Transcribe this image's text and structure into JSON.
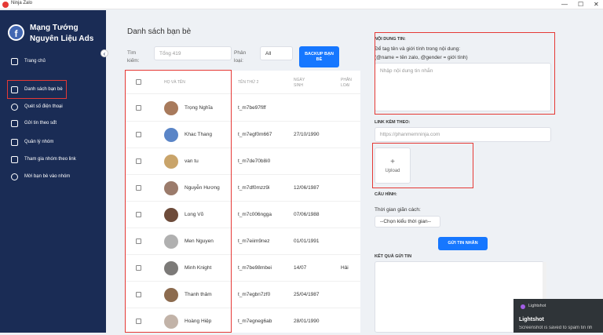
{
  "window": {
    "title": "Ninja Zalo",
    "min": "—",
    "max": "☐",
    "close": "✕"
  },
  "brand": {
    "logo": "f",
    "line1": "Mạng Tướng",
    "line2": "Nguyên Liệu Ads",
    "collapse": "‹"
  },
  "nav": [
    {
      "label": "Trang chủ"
    },
    {
      "label": "Danh sách bạn bè"
    },
    {
      "label": "Quét số điện thoại"
    },
    {
      "label": "Gửi tin theo sđt"
    },
    {
      "label": "Quản lý nhóm"
    },
    {
      "label": "Tham gia nhóm theo link"
    },
    {
      "label": "Mời bạn bè vào nhóm"
    }
  ],
  "page": {
    "title": "Danh sách bạn bè",
    "search_label": "Tìm kiếm:",
    "search_placeholder": "Tổng 419",
    "filter_label": "Phân loại:",
    "filter_value": "All",
    "backup_button": "BACKUP BẠN BÈ"
  },
  "table": {
    "headers": [
      "HỌ VÀ TÊN",
      "TÊN THỨ 2",
      "NGÀY SINH",
      "PHÂN LOẠI"
    ],
    "rows": [
      {
        "name": "Trọng Nghĩa",
        "alias": "t_m7be97fiff",
        "dob": "",
        "type": ""
      },
      {
        "name": "Khac Thang",
        "alias": "t_m7egf0m667",
        "dob": "27/10/1990",
        "type": ""
      },
      {
        "name": "van tu",
        "alias": "t_m7de70b8i0",
        "dob": "",
        "type": ""
      },
      {
        "name": "Nguyễn Hương",
        "alias": "t_m7df0mzz9i",
        "dob": "12/06/1987",
        "type": ""
      },
      {
        "name": "Long Võ",
        "alias": "t_m7c006ngga",
        "dob": "07/06/1988",
        "type": ""
      },
      {
        "name": "Men Nguyen",
        "alias": "t_m7eiim9nez",
        "dob": "01/01/1991",
        "type": ""
      },
      {
        "name": "Minh Knight",
        "alias": "t_m7be98mbei",
        "dob": "14/07",
        "type": "Hải"
      },
      {
        "name": "Thanh thảm",
        "alias": "t_m7egbn7zf0",
        "dob": "25/04/1987",
        "type": ""
      },
      {
        "name": "Hoàng Hiệp",
        "alias": "t_m7egneg6ab",
        "dob": "28/01/1990",
        "type": ""
      }
    ]
  },
  "panel": {
    "content_label": "NỘI DUNG TIN:",
    "hint1": "Để tag tên và giới tính trong nội dung:",
    "hint2": "(@name = tên zalo, @gender = giới tính)",
    "message_placeholder": "Nhập nội dung tin nhắn",
    "link_label": "LINK KÈM THEO:",
    "link_placeholder": "https://phanmemninja.com",
    "upload_plus": "+",
    "upload_label": "Upload",
    "config_label": "CẤU HÌNH:",
    "interval_label": "Thời gian giãn cách:",
    "interval_placeholder": "--Chọn kiểu thời gian--",
    "send_button": "GỬI TIN NHẮN",
    "result_label": "KẾT QUẢ GỬI TIN"
  },
  "toast": {
    "app": "Lightshot",
    "title": "Lightshot",
    "text": "Screenshot is saved to spam tin nh"
  },
  "colors": {
    "sidebar": "#1a2c55",
    "accent": "#1677ff",
    "highlight": "#e53935"
  }
}
